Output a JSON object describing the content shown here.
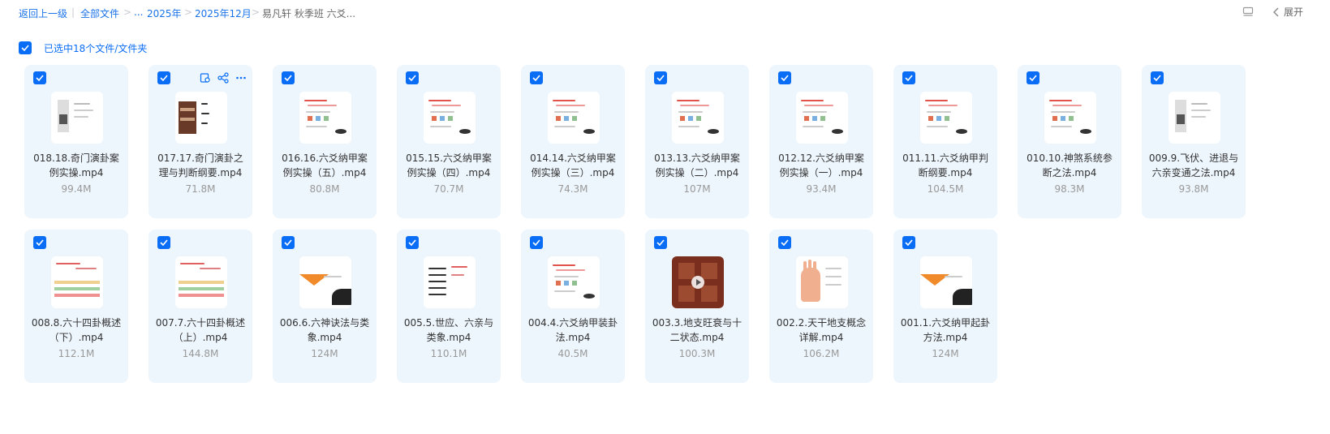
{
  "breadcrumb": {
    "back": "返回上一级",
    "separator": "|",
    "items": [
      "全部文件",
      "...",
      "2025年",
      "2025年12月",
      "易凡轩 秋季班 六爻..."
    ],
    "arrow": ">"
  },
  "toolbar": {
    "expand_label": "展开"
  },
  "selection": {
    "text": "已选中18个文件/文件夹"
  },
  "colors": {
    "accent": "#0a6df5",
    "link": "#1a73e8",
    "card_bg": "#eef6fd"
  },
  "files": [
    {
      "name": "018.18.奇门演卦案例实操.mp4",
      "size": "99.4M",
      "thumb": "table"
    },
    {
      "name": "017.17.奇门演卦之理与判断纲要.mp4",
      "size": "71.8M",
      "thumb": "wood"
    },
    {
      "name": "016.16.六爻纳甲案例实操（五）.mp4",
      "size": "80.8M",
      "thumb": "notes"
    },
    {
      "name": "015.15.六爻纳甲案例实操（四）.mp4",
      "size": "70.7M",
      "thumb": "notes"
    },
    {
      "name": "014.14.六爻纳甲案例实操（三）.mp4",
      "size": "74.3M",
      "thumb": "notes"
    },
    {
      "name": "013.13.六爻纳甲案例实操（二）.mp4",
      "size": "107M",
      "thumb": "notes"
    },
    {
      "name": "012.12.六爻纳甲案例实操（一）.mp4",
      "size": "93.4M",
      "thumb": "notes"
    },
    {
      "name": "011.11.六爻纳甲判断纲要.mp4",
      "size": "104.5M",
      "thumb": "notes"
    },
    {
      "name": "010.10.神煞系统参断之法.mp4",
      "size": "98.3M",
      "thumb": "notes"
    },
    {
      "name": "009.9.飞伏、进退与六亲变通之法.mp4",
      "size": "93.8M",
      "thumb": "table"
    },
    {
      "name": "008.8.六十四卦概述（下）.mp4",
      "size": "112.1M",
      "thumb": "grid"
    },
    {
      "name": "007.7.六十四卦概述（上）.mp4",
      "size": "144.8M",
      "thumb": "grid"
    },
    {
      "name": "006.6.六神诀法与类象.mp4",
      "size": "124M",
      "thumb": "slide"
    },
    {
      "name": "005.5.世应、六亲与类象.mp4",
      "size": "110.1M",
      "thumb": "lines"
    },
    {
      "name": "004.4.六爻纳甲装卦法.mp4",
      "size": "40.5M",
      "thumb": "notes"
    },
    {
      "name": "003.3.地支旺衰与十二状态.mp4",
      "size": "100.3M",
      "thumb": "wood2"
    },
    {
      "name": "002.2.天干地支概念详解.mp4",
      "size": "106.2M",
      "thumb": "hand"
    },
    {
      "name": "001.1.六爻纳甲起卦方法.mp4",
      "size": "124M",
      "thumb": "slide"
    }
  ]
}
